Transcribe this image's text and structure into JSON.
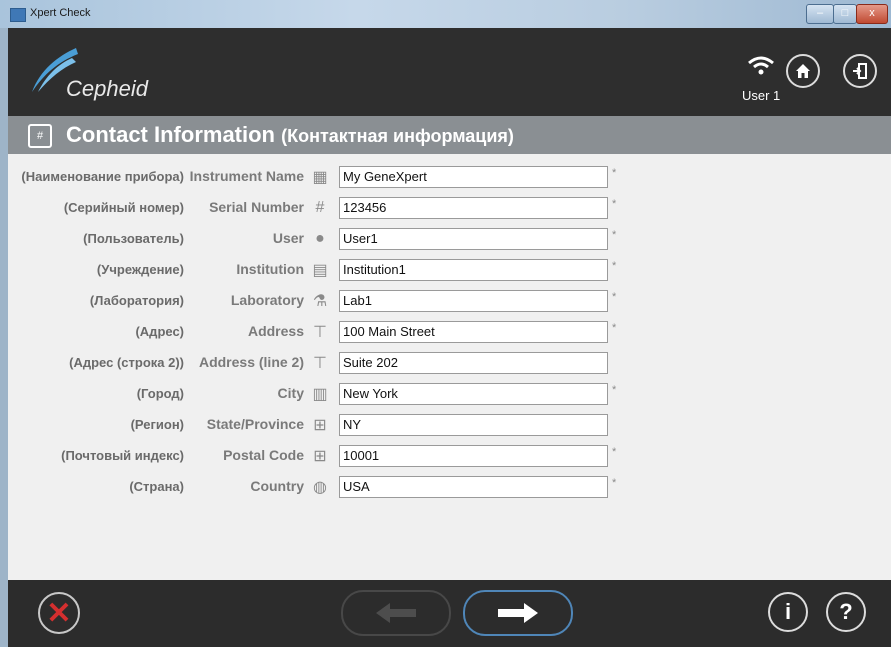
{
  "window": {
    "title": "Xpert Check",
    "controls": {
      "minimize": "–",
      "maximize": "□",
      "close": "x"
    }
  },
  "header": {
    "logo_text": "Cepheid",
    "user_label": "User 1",
    "home_icon": "home-icon",
    "exit_icon": "exit-icon",
    "wifi_icon": "wifi-icon"
  },
  "section": {
    "title": "Contact Information",
    "subtitle": "(Контактная информация)",
    "icon": "contact-card-icon"
  },
  "form": {
    "required_marker": "*",
    "fields": [
      {
        "ru": "(Наименование прибора)",
        "en": "Instrument Name",
        "icon": "instrument-icon",
        "value": "My GeneXpert",
        "required": true
      },
      {
        "ru": "(Серийный номер)",
        "en": "Serial Number",
        "icon": "hash-icon",
        "value": "123456",
        "required": true
      },
      {
        "ru": "(Пользователь)",
        "en": "User",
        "icon": "person-icon",
        "value": "User1",
        "required": true
      },
      {
        "ru": "(Учреждение)",
        "en": "Institution",
        "icon": "building-icon",
        "value": "Institution1",
        "required": true
      },
      {
        "ru": "(Лаборатория)",
        "en": "Laboratory",
        "icon": "flask-icon",
        "value": "Lab1",
        "required": true
      },
      {
        "ru": "(Адрес)",
        "en": "Address",
        "icon": "street-sign-icon",
        "value": "100 Main Street",
        "required": true
      },
      {
        "ru": "(Адрес (строка 2))",
        "en": "Address (line 2)",
        "icon": "street-sign-icon",
        "value": "Suite 202",
        "required": false
      },
      {
        "ru": "(Город)",
        "en": "City",
        "icon": "city-icon",
        "value": "New York",
        "required": true
      },
      {
        "ru": "(Регион)",
        "en": "State/Province",
        "icon": "map-grid-icon",
        "value": "NY",
        "required": false
      },
      {
        "ru": "(Почтовый индекс)",
        "en": "Postal Code",
        "icon": "map-grid-icon",
        "value": "10001",
        "required": true
      },
      {
        "ru": "(Страна)",
        "en": "Country",
        "icon": "globe-icon",
        "value": "USA",
        "required": true
      }
    ]
  },
  "footer": {
    "cancel_icon": "cancel-x-icon",
    "back_icon": "arrow-left-icon",
    "next_icon": "arrow-right-icon",
    "info_label": "i",
    "help_label": "?"
  },
  "colors": {
    "header_bg": "#2e2e2e",
    "section_bg": "#8a8f93",
    "content_bg": "#f0f0f0",
    "next_border": "#4f86b8",
    "cancel_red": "#d42f2f"
  }
}
